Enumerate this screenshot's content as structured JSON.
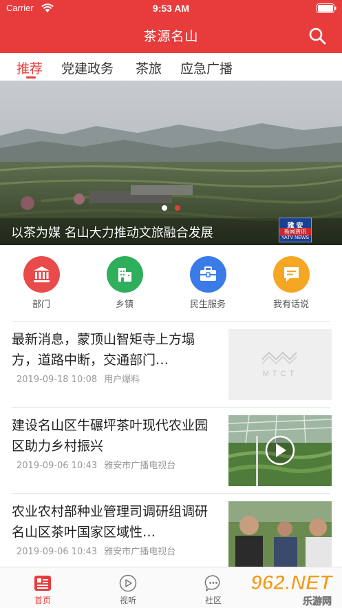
{
  "status_bar": {
    "carrier": "Carrier",
    "time": "9:53 AM"
  },
  "header": {
    "title": "茶源名山",
    "search_icon": "search-icon"
  },
  "tabs": [
    {
      "label": "推荐",
      "active": true
    },
    {
      "label": "党建政务",
      "active": false
    },
    {
      "label": "茶旅",
      "active": false
    },
    {
      "label": "应急广播",
      "active": false
    }
  ],
  "banner": {
    "caption": "以茶为媒 名山大力推动文旅融合发展",
    "page_count": 2,
    "active_page": 1,
    "logo_top": "雅 安",
    "logo_mid": "新闻资讯",
    "logo_bottom": "YATV NEWS"
  },
  "services": [
    {
      "label": "部门",
      "icon": "bank-icon",
      "color": "#e94b4b"
    },
    {
      "label": "乡镇",
      "icon": "building-icon",
      "color": "#2fae5b"
    },
    {
      "label": "民生服务",
      "icon": "briefcase-icon",
      "color": "#3a7be8"
    },
    {
      "label": "我有话说",
      "icon": "message-icon",
      "color": "#f5a623"
    }
  ],
  "news": [
    {
      "title": "最新消息，蒙顶山智矩寺上方塌方，道路中断，交通部门…",
      "date": "2019-09-18 10:08",
      "source": "用户爆料",
      "thumb_text": "MTCT",
      "has_video": false
    },
    {
      "title": "建设名山区牛碾坪茶叶现代农业园区助力乡村振兴",
      "date": "2019-09-06 10:43",
      "source": "雅安市广播电视台",
      "has_video": true
    },
    {
      "title": "农业农村部种业管理司调研组调研名山区茶叶国家区域性…",
      "date": "2019-09-06 10:43",
      "source": "雅安市广播电视台",
      "has_video": false
    }
  ],
  "bottom_nav": [
    {
      "label": "首页",
      "icon": "news-icon",
      "active": true
    },
    {
      "label": "视听",
      "icon": "play-icon",
      "active": false
    },
    {
      "label": "社区",
      "icon": "chat-icon",
      "active": false
    }
  ],
  "watermark": {
    "text": "962.NET",
    "sub": "乐游网"
  },
  "colors": {
    "primary": "#e83c3c",
    "text": "#222222",
    "meta": "#999999"
  }
}
